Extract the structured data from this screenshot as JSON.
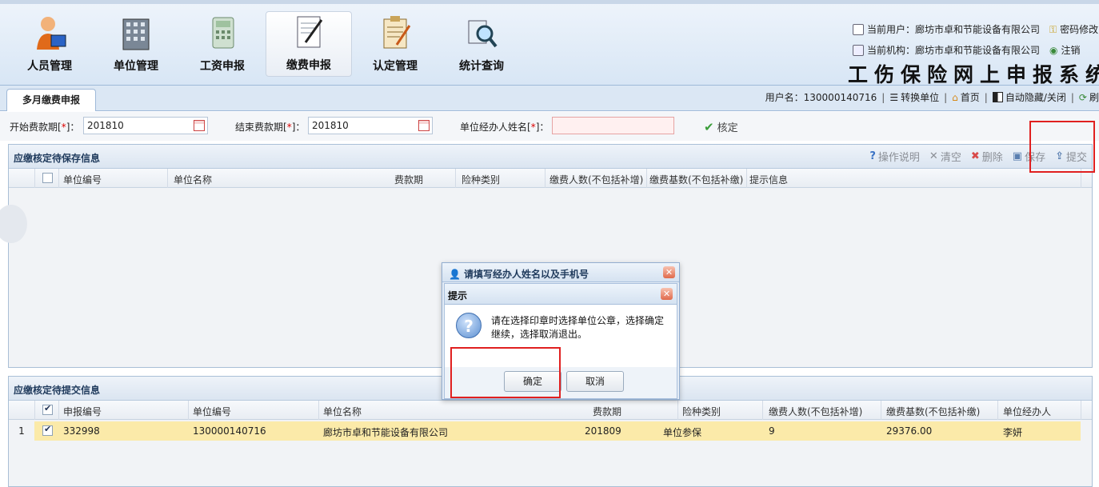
{
  "header": {
    "modules": [
      {
        "label": "人员管理",
        "icon": "person-icon",
        "active": false
      },
      {
        "label": "单位管理",
        "icon": "building-icon",
        "active": false
      },
      {
        "label": "工资申报",
        "icon": "calculator-icon",
        "active": false
      },
      {
        "label": "缴费申报",
        "icon": "document-pen-icon",
        "active": true
      },
      {
        "label": "认定管理",
        "icon": "clipboard-icon",
        "active": false
      },
      {
        "label": "统计查询",
        "icon": "magnifier-icon",
        "active": false
      }
    ],
    "current_user": "当前用户：廊坊市卓和节能设备有限公司",
    "password_link": "密码修改",
    "current_org": "当前机构：廊坊市卓和节能设备有限公司",
    "logout_link": "注销",
    "system_title": "工伤保险网上申报系统"
  },
  "tabbar": {
    "active_tab": "多月缴费申报",
    "username": "用户名：130000140716",
    "switch_unit": "转换单位",
    "home": "首页",
    "auto_hide": "自动隐藏/关闭",
    "refresh": "刷"
  },
  "filter": {
    "start_label": "开始费款期",
    "start_value": "201810",
    "end_label": "结束费款期",
    "end_value": "201810",
    "agent_label": "单位经办人姓名",
    "agent_value": "",
    "req_mark": "*",
    "verify_label": "核定"
  },
  "pending_save": {
    "title": "应缴核定待保存信息",
    "actions": {
      "help": "操作说明",
      "clear": "清空",
      "delete": "删除",
      "save": "保存",
      "submit": "提交"
    },
    "columns": [
      "单位编号",
      "单位名称",
      "费款期",
      "险种类别",
      "缴费人数(不包括补增)",
      "缴费基数(不包括补缴)",
      "提示信息"
    ]
  },
  "pending_submit": {
    "title": "应缴核定待提交信息",
    "columns": [
      "申报编号",
      "单位编号",
      "单位名称",
      "费款期",
      "险种类别",
      "缴费人数(不包括补增)",
      "缴费基数(不包括补缴)",
      "单位经办人"
    ],
    "rows": [
      {
        "num": "1",
        "checked": true,
        "report_no": "332998",
        "unit_no": "130000140716",
        "unit_name": "廊坊市卓和节能设备有限公司",
        "period": "201809",
        "type": "单位参保",
        "count": "9",
        "base": "29376.00",
        "agent": "李妍"
      }
    ]
  },
  "dialog_outer": {
    "title": "请填写经办人姓名以及手机号"
  },
  "dialog_prompt": {
    "title": "提示",
    "message": "请在选择印章时选择单位公章，选择确定继续，选择取消退出。",
    "ok": "确定",
    "cancel": "取消"
  },
  "colors": {
    "highlight_box": "#e02020",
    "selected_row": "#fbeaa9"
  }
}
